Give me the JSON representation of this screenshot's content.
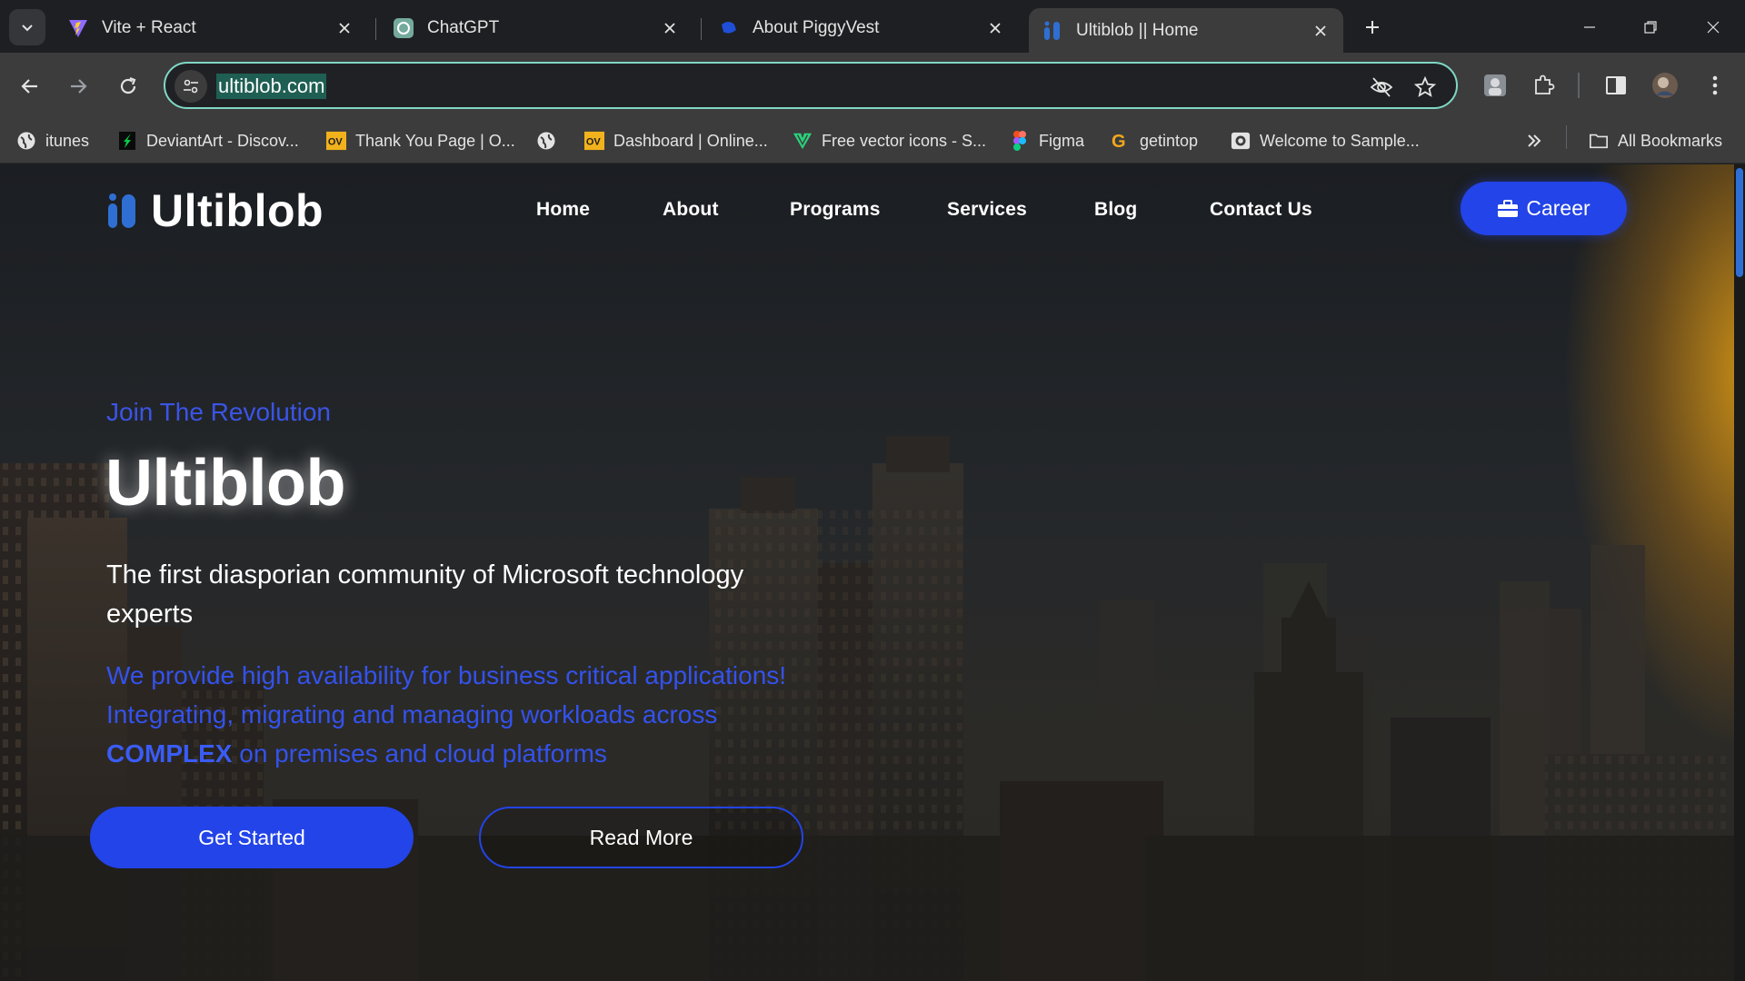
{
  "browser": {
    "tabs": [
      {
        "title": "Vite + React",
        "icon": "vite-icon",
        "active": false
      },
      {
        "title": "ChatGPT",
        "icon": "chatgpt-icon",
        "active": false
      },
      {
        "title": "About PiggyVest",
        "icon": "piggyvest-icon",
        "active": false
      },
      {
        "title": "Ultiblob || Home",
        "icon": "ultiblob-icon",
        "active": true
      }
    ],
    "url": "ultiblob.com",
    "bookmarks": [
      {
        "label": "itunes",
        "icon": "globe-icon"
      },
      {
        "label": "DeviantArt - Discov...",
        "icon": "deviantart-icon"
      },
      {
        "label": "Thank You Page | O...",
        "icon": "ov-icon"
      },
      {
        "label": "",
        "icon": "globe-icon"
      },
      {
        "label": "Dashboard | Online...",
        "icon": "ov-icon"
      },
      {
        "label": "Free vector icons - S...",
        "icon": "vector-icon"
      },
      {
        "label": "Figma",
        "icon": "figma-icon"
      },
      {
        "label": "getintop",
        "icon": "g-icon"
      },
      {
        "label": "Welcome to Sample...",
        "icon": "camera-icon"
      }
    ],
    "all_bookmarks_label": "All Bookmarks",
    "accent_color": "#7fd8c5"
  },
  "site": {
    "logo_text": "Ultiblob",
    "nav": [
      "Home",
      "About",
      "Programs",
      "Services",
      "Blog",
      "Contact Us"
    ],
    "career_label": "Career",
    "hero": {
      "kicker": "Join The Revolution",
      "title": "Ultiblob",
      "subtitle": "The first diasporian community of Microsoft technology experts",
      "desc_line1": "We provide high availability for business critical applications!",
      "desc_line2": "Integrating, migrating and managing workloads across",
      "desc_strong": "COMPLEX",
      "desc_line3_rest": " on premises and cloud platforms",
      "primary_cta": "Get Started",
      "secondary_cta": "Read More"
    },
    "brand_color": "#2344e8"
  }
}
